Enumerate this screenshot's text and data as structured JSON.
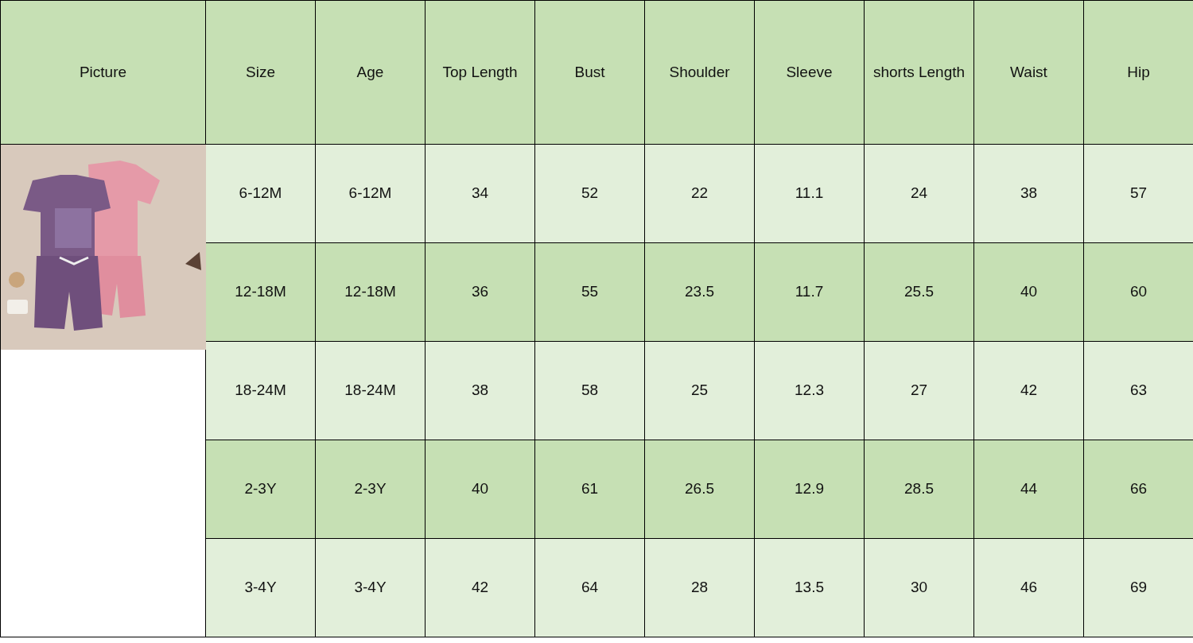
{
  "table": {
    "columns": [
      "Picture",
      "Size",
      "Age",
      "Top Length",
      "Bust",
      "Shoulder",
      "Sleeve",
      "shorts Length",
      "Waist",
      "Hip"
    ],
    "rows": [
      {
        "cells": [
          "",
          "6-12M",
          "6-12M",
          "34",
          "52",
          "22",
          "11.1",
          "24",
          "38",
          "57"
        ]
      },
      {
        "cells": [
          "",
          "12-18M",
          "12-18M",
          "36",
          "55",
          "23.5",
          "11.7",
          "25.5",
          "40",
          "60"
        ]
      },
      {
        "cells": [
          "",
          "18-24M",
          "18-24M",
          "38",
          "58",
          "25",
          "12.3",
          "27",
          "42",
          "63"
        ]
      },
      {
        "cells": [
          "",
          "2-3Y",
          "2-3Y",
          "40",
          "61",
          "26.5",
          "12.9",
          "28.5",
          "44",
          "66"
        ]
      },
      {
        "cells": [
          "",
          "3-4Y",
          "3-4Y",
          "42",
          "64",
          "28",
          "13.5",
          "30",
          "46",
          "69"
        ]
      }
    ]
  }
}
